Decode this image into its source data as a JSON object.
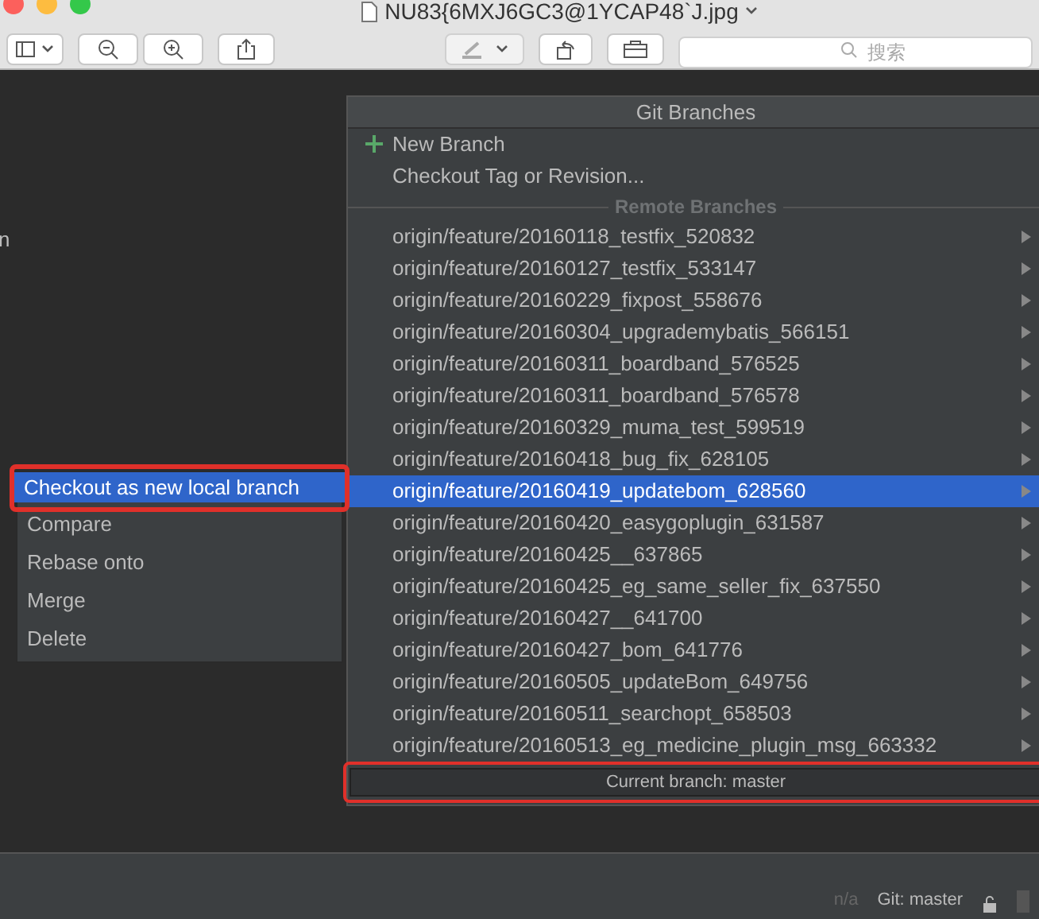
{
  "window": {
    "title": "NU83{6MXJ6GC3@1YCAP48`J.jpg"
  },
  "toolbar": {
    "search": {
      "placeholder": "搜索"
    }
  },
  "editor": {
    "fragment": "n"
  },
  "git_branches": {
    "title": "Git Branches",
    "actions": [
      {
        "kind": "new",
        "label": "New Branch"
      },
      {
        "kind": "plain",
        "label": "Checkout Tag or Revision..."
      }
    ],
    "section": "Remote Branches",
    "branches": [
      {
        "name": "origin/feature/20160118_testfix_520832",
        "selected": false
      },
      {
        "name": "origin/feature/20160127_testfix_533147",
        "selected": false
      },
      {
        "name": "origin/feature/20160229_fixpost_558676",
        "selected": false
      },
      {
        "name": "origin/feature/20160304_upgrademybatis_566151",
        "selected": false
      },
      {
        "name": "origin/feature/20160311_boardband_576525",
        "selected": false
      },
      {
        "name": "origin/feature/20160311_boardband_576578",
        "selected": false
      },
      {
        "name": "origin/feature/20160329_muma_test_599519",
        "selected": false
      },
      {
        "name": "origin/feature/20160418_bug_fix_628105",
        "selected": false
      },
      {
        "name": "origin/feature/20160419_updatebom_628560",
        "selected": true
      },
      {
        "name": "origin/feature/20160420_easygoplugin_631587",
        "selected": false
      },
      {
        "name": "origin/feature/20160425__637865",
        "selected": false
      },
      {
        "name": "origin/feature/20160425_eg_same_seller_fix_637550",
        "selected": false
      },
      {
        "name": "origin/feature/20160427__641700",
        "selected": false
      },
      {
        "name": "origin/feature/20160427_bom_641776",
        "selected": false
      },
      {
        "name": "origin/feature/20160505_updateBom_649756",
        "selected": false
      },
      {
        "name": "origin/feature/20160511_searchopt_658503",
        "selected": false
      },
      {
        "name": "origin/feature/20160513_eg_medicine_plugin_msg_663332",
        "selected": false
      }
    ],
    "footer": {
      "text": "Current branch: master",
      "highlighted": true
    }
  },
  "context_menu": [
    {
      "label": "Checkout as new local branch",
      "selected": true,
      "highlighted": true
    },
    {
      "label": "Compare",
      "selected": false,
      "highlighted": false
    },
    {
      "label": "Rebase onto",
      "selected": false,
      "highlighted": false
    },
    {
      "label": "Merge",
      "selected": false,
      "highlighted": false
    },
    {
      "label": "Delete",
      "selected": false,
      "highlighted": false
    }
  ],
  "status_bar": {
    "items": [
      "n/a",
      "Git: master"
    ]
  }
}
